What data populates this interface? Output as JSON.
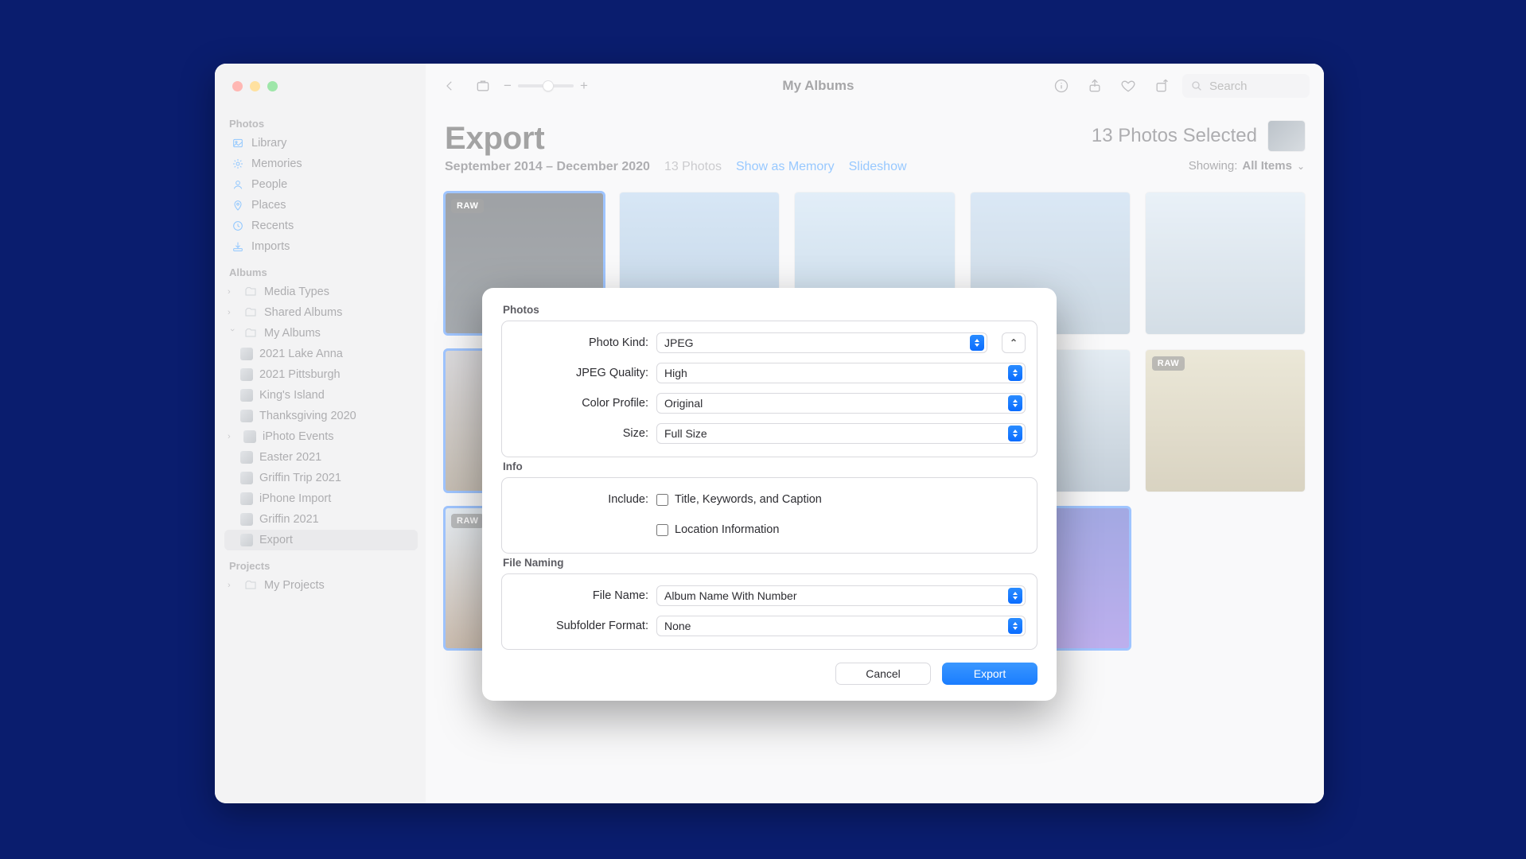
{
  "toolbar": {
    "title": "My Albums",
    "search_placeholder": "Search",
    "zoom_minus": "−",
    "zoom_plus": "+"
  },
  "sidebar": {
    "photos_head": "Photos",
    "photos": [
      {
        "label": "Library"
      },
      {
        "label": "Memories"
      },
      {
        "label": "People"
      },
      {
        "label": "Places"
      },
      {
        "label": "Recents"
      },
      {
        "label": "Imports"
      }
    ],
    "albums_head": "Albums",
    "albums_top": [
      {
        "label": "Media Types",
        "chev": true
      },
      {
        "label": "Shared Albums",
        "chev": true
      },
      {
        "label": "My Albums",
        "chev": true,
        "open": true
      }
    ],
    "my_albums": [
      {
        "label": "2021 Lake Anna"
      },
      {
        "label": "2021 Pittsburgh"
      },
      {
        "label": "King's Island"
      },
      {
        "label": "Thanksgiving 2020"
      },
      {
        "label": "iPhoto Events",
        "chev": true
      },
      {
        "label": "Easter 2021"
      },
      {
        "label": "Griffin Trip 2021"
      },
      {
        "label": "iPhone Import"
      },
      {
        "label": "Griffin 2021"
      },
      {
        "label": "Export",
        "active": true
      }
    ],
    "projects_head": "Projects",
    "projects": [
      {
        "label": "My Projects",
        "chev": true
      }
    ]
  },
  "header": {
    "title": "Export",
    "range": "September 2014 – December 2020",
    "count": "13 Photos",
    "show_memory": "Show as Memory",
    "slideshow": "Slideshow",
    "selected": "13 Photos Selected",
    "showing_label": "Showing:",
    "showing_value": "All Items"
  },
  "grid": {
    "raw_badge": "RAW",
    "items": [
      {
        "t": "t1",
        "sel": true,
        "raw": true
      },
      {
        "t": "t2"
      },
      {
        "t": "t3"
      },
      {
        "t": "t4"
      },
      {
        "t": "t5"
      },
      {
        "t": "t6",
        "sel": true
      },
      {
        "t": "t7"
      },
      {
        "t": "t8"
      },
      {
        "t": "t8"
      },
      {
        "t": "t9",
        "raw": true
      },
      {
        "t": "t10",
        "sel": true,
        "raw": true
      },
      {
        "t": "t11",
        "sel": true
      },
      {
        "t": "t12",
        "sel": true
      },
      {
        "t": "t13",
        "sel": true
      },
      {
        "t": ""
      }
    ]
  },
  "dialog": {
    "sect_photos": "Photos",
    "photo_kind_lbl": "Photo Kind:",
    "photo_kind": "JPEG",
    "jpeg_quality_lbl": "JPEG Quality:",
    "jpeg_quality": "High",
    "color_profile_lbl": "Color Profile:",
    "color_profile": "Original",
    "size_lbl": "Size:",
    "size": "Full Size",
    "sect_info": "Info",
    "include_lbl": "Include:",
    "include_title": "Title, Keywords, and Caption",
    "include_location": "Location Information",
    "sect_filenaming": "File Naming",
    "file_name_lbl": "File Name:",
    "file_name": "Album Name With Number",
    "subfolder_lbl": "Subfolder Format:",
    "subfolder": "None",
    "cancel": "Cancel",
    "export": "Export"
  }
}
